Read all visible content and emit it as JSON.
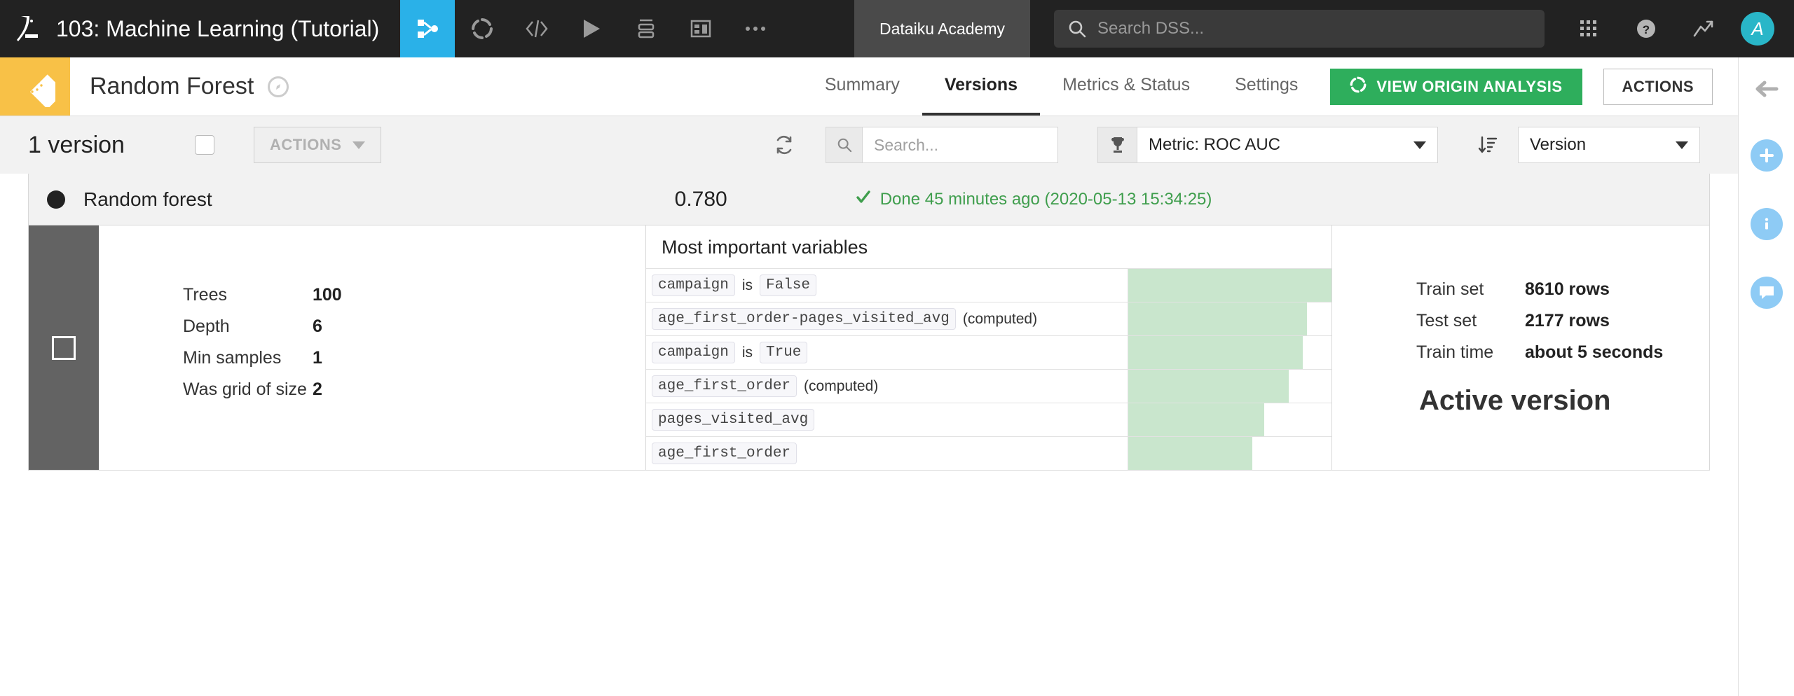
{
  "topbar": {
    "logo_icon": "dataiku-bird-logo",
    "project_title": "103: Machine Learning (Tutorial)",
    "nav_icons": [
      {
        "name": "flow-icon",
        "active": true
      },
      {
        "name": "lab-icon",
        "active": false
      },
      {
        "name": "code-icon",
        "active": false
      },
      {
        "name": "run-job-icon",
        "active": false
      },
      {
        "name": "automation-icon",
        "active": false
      },
      {
        "name": "dashboard-icon",
        "active": false
      },
      {
        "name": "more-options-icon",
        "active": false
      }
    ],
    "account_label": "Dataiku Academy",
    "search_placeholder": "Search DSS...",
    "search_value": "",
    "right_icons": [
      "apps-grid-icon",
      "help-icon",
      "trending-icon"
    ],
    "avatar_initial": "A"
  },
  "subbar": {
    "model_icon": "saved-model-icon",
    "model_name": "Random Forest",
    "tabs": [
      {
        "label": "Summary",
        "active": false
      },
      {
        "label": "Versions",
        "active": true
      },
      {
        "label": "Metrics & Status",
        "active": false
      },
      {
        "label": "Settings",
        "active": false
      }
    ],
    "origin_button": "VIEW ORIGIN ANALYSIS",
    "actions_button": "ACTIONS"
  },
  "toolbar": {
    "version_count": "1 version",
    "actions_dropdown": "ACTIONS",
    "search_placeholder": "Search...",
    "search_value": "",
    "metric_label": "Metric: ROC AUC",
    "sort_label": "Version"
  },
  "version_row": {
    "algorithm": "Random forest",
    "score": "0.780",
    "status": "Done 45 minutes ago (2020-05-13 15:34:25)"
  },
  "parameters": [
    {
      "label": "Trees",
      "value": "100"
    },
    {
      "label": "Depth",
      "value": "6"
    },
    {
      "label": "Min samples",
      "value": "1"
    },
    {
      "label": "Was grid of size",
      "value": "2"
    }
  ],
  "variables": {
    "title": "Most important variables",
    "rows": [
      {
        "pill": "campaign",
        "mid": "is",
        "pill2": "False",
        "suffix": "",
        "bar_pct": 100
      },
      {
        "pill": "age_first_order-pages_visited_avg",
        "mid": "",
        "pill2": "",
        "suffix": "(computed)",
        "bar_pct": 88
      },
      {
        "pill": "campaign",
        "mid": "is",
        "pill2": "True",
        "suffix": "",
        "bar_pct": 86
      },
      {
        "pill": "age_first_order",
        "mid": "",
        "pill2": "",
        "suffix": "(computed)",
        "bar_pct": 79
      },
      {
        "pill": "pages_visited_avg",
        "mid": "",
        "pill2": "",
        "suffix": "",
        "bar_pct": 67
      },
      {
        "pill": "age_first_order",
        "mid": "",
        "pill2": "",
        "suffix": "",
        "bar_pct": 61
      }
    ]
  },
  "stats": {
    "rows": [
      {
        "label": "Train set",
        "value": "8610 rows"
      },
      {
        "label": "Test set",
        "value": "2177 rows"
      },
      {
        "label": "Train time",
        "value": "about 5 seconds"
      }
    ],
    "active_version": "Active version"
  },
  "rail": {
    "icons": [
      "collapse-left-icon",
      "add-icon",
      "info-icon",
      "discussions-icon"
    ]
  },
  "colors": {
    "topbar_bg": "#222222",
    "accent_blue": "#2ab1e8",
    "model_tile": "#f8c147",
    "green_button": "#2eae5c",
    "status_green": "#3f9e4d",
    "bar_green": "#c9e6cd",
    "selection_gray": "#636363"
  }
}
